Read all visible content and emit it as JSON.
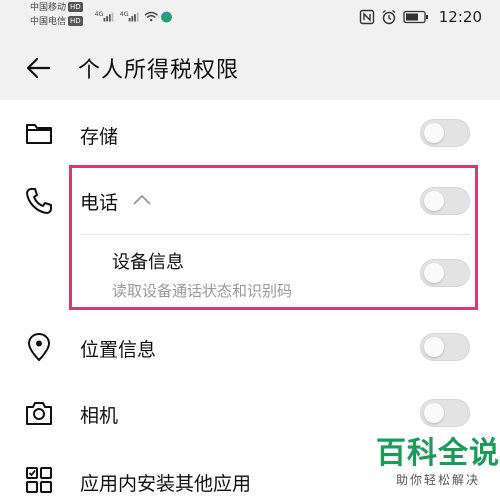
{
  "status_bar": {
    "carrier1": "中国移动",
    "carrier2": "中国电信",
    "hd1": "HD",
    "hd2": "HD",
    "signal1_tag": "4G",
    "signal2_tag": "4G",
    "time": "12:20",
    "icons": [
      "signal-icon",
      "wifi-icon",
      "app-notification-icon",
      "nfc-icon",
      "alarm-icon",
      "battery-icon"
    ]
  },
  "header": {
    "title": "个人所得税权限"
  },
  "permissions": {
    "storage": {
      "label": "存储",
      "enabled": false
    },
    "phone": {
      "label": "电话",
      "enabled": false,
      "sub_item": {
        "label": "设备信息",
        "description": "读取设备通话状态和识别码",
        "enabled": false
      }
    },
    "location": {
      "label": "位置信息",
      "enabled": false
    },
    "camera": {
      "label": "相机",
      "enabled": false
    },
    "install_apps": {
      "label": "应用内安装其他应用",
      "enabled": false
    }
  },
  "watermark": {
    "title": "百科全说",
    "subtitle": "助你轻松解决"
  },
  "colors": {
    "highlight_border": "#d23a78",
    "watermark_green": "#1a9b57",
    "toggle_off": "#e3e3e3",
    "header_bg": "#f1f1f1"
  }
}
